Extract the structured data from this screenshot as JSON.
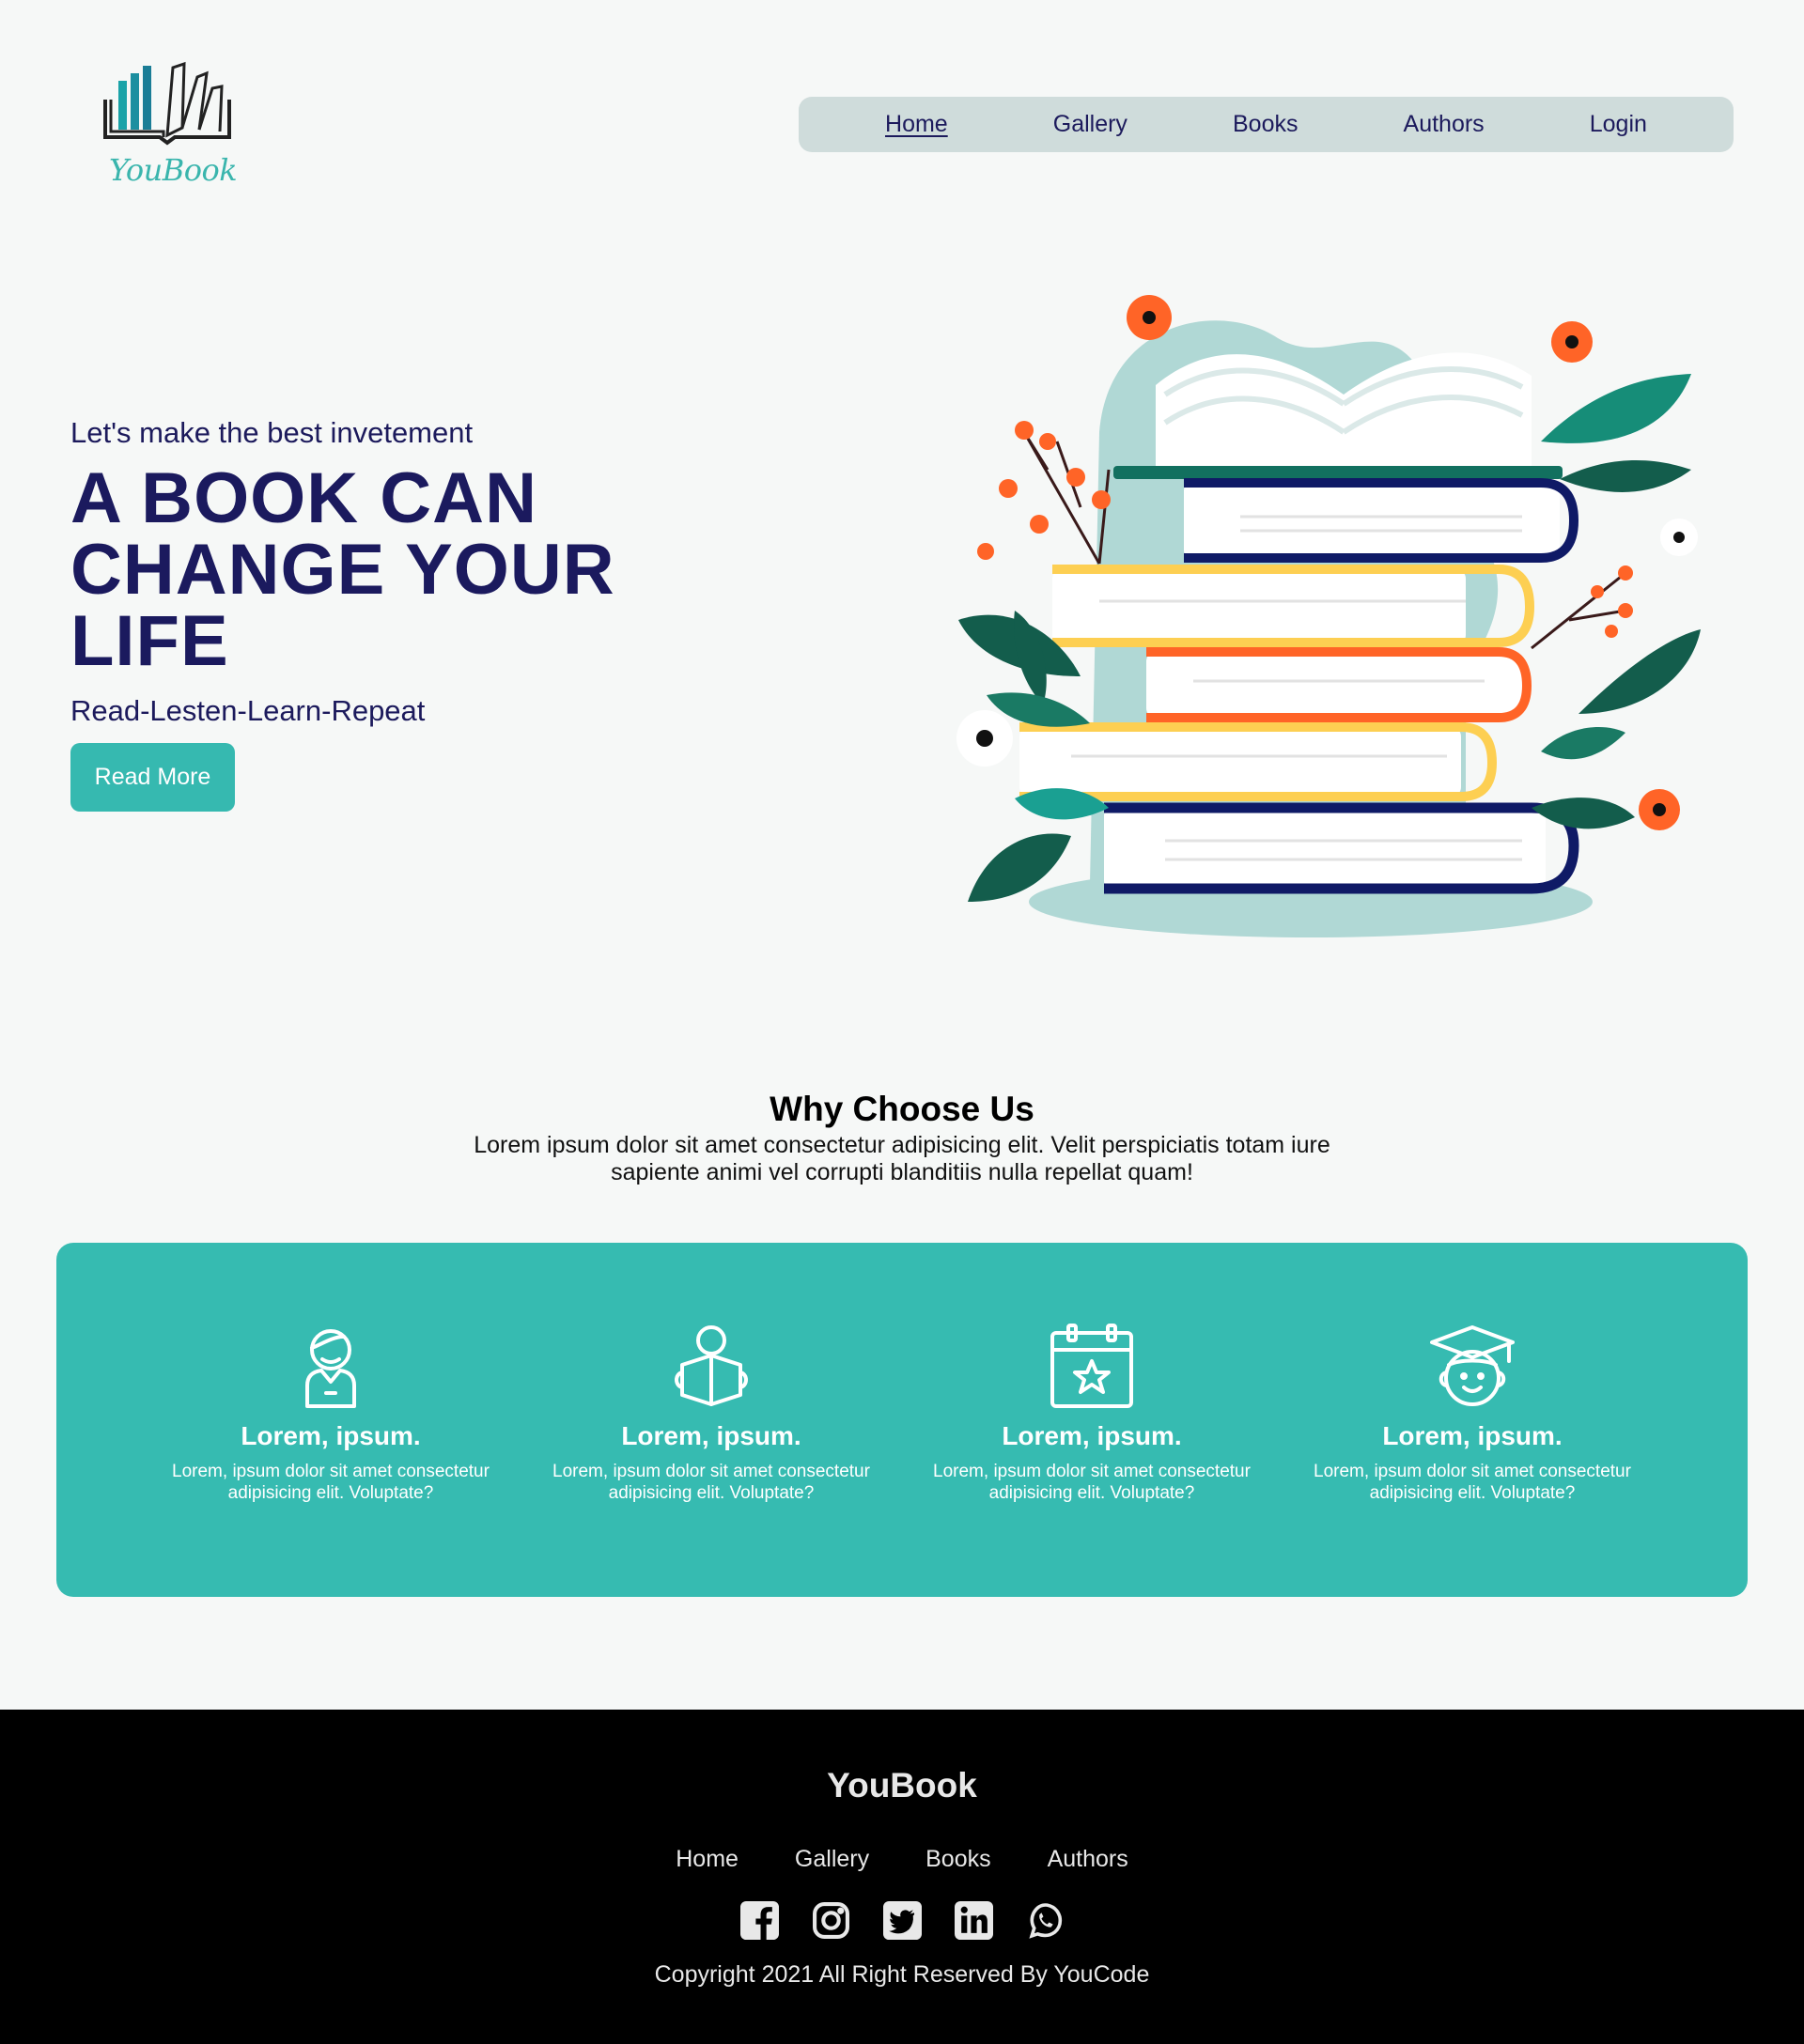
{
  "brand": {
    "logo_text": "YouBook"
  },
  "nav": {
    "items": [
      {
        "label": "Home",
        "active": true
      },
      {
        "label": "Gallery",
        "active": false
      },
      {
        "label": "Books",
        "active": false
      },
      {
        "label": "Authors",
        "active": false
      },
      {
        "label": "Login",
        "active": false
      }
    ]
  },
  "hero": {
    "subtitle": "Let's make the best invetement",
    "title_lines": [
      "A BOOK CAN",
      "CHANGE YOUR",
      "LIFE"
    ],
    "tagline": "Read-Lesten-Learn-Repeat",
    "button_label": "Read More"
  },
  "why": {
    "title": "Why Choose Us",
    "text": "Lorem ipsum dolor sit amet consectetur adipisicing elit. Velit perspiciatis totam iure sapiente animi vel corrupti blanditiis nulla repellat quam!"
  },
  "features": [
    {
      "icon": "person-icon",
      "title": "Lorem, ipsum.",
      "text": "Lorem, ipsum dolor sit amet consectetur adipisicing elit. Voluptate?"
    },
    {
      "icon": "reader-icon",
      "title": "Lorem, ipsum.",
      "text": "Lorem, ipsum dolor sit amet consectetur adipisicing elit. Voluptate?"
    },
    {
      "icon": "calendar-star-icon",
      "title": "Lorem, ipsum.",
      "text": "Lorem, ipsum dolor sit amet consectetur adipisicing elit. Voluptate?"
    },
    {
      "icon": "graduate-icon",
      "title": "Lorem, ipsum.",
      "text": "Lorem, ipsum dolor sit amet consectetur adipisicing elit. Voluptate?"
    }
  ],
  "footer": {
    "brand": "YouBook",
    "links": [
      "Home",
      "Gallery",
      "Books",
      "Authors"
    ],
    "socials": [
      "facebook-icon",
      "instagram-icon",
      "twitter-icon",
      "linkedin-icon",
      "whatsapp-icon"
    ],
    "copyright": "Copyright 2021 All Right Reserved By YouCode"
  },
  "colors": {
    "background": "#f6f8f7",
    "primary_text": "#1b1a5e",
    "accent": "#36bbb1",
    "nav_bg": "#cfdcdb",
    "footer_bg": "#000000"
  }
}
